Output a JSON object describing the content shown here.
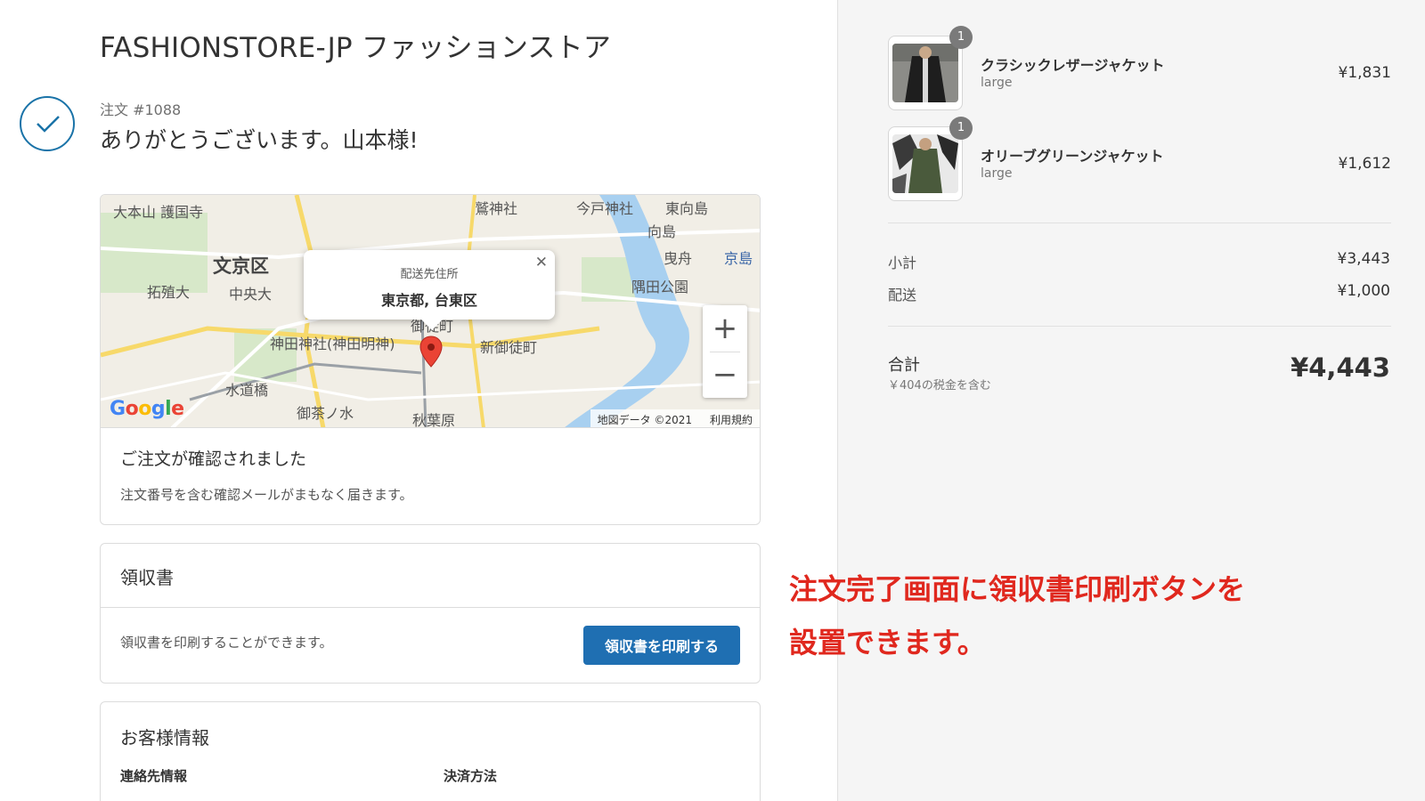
{
  "store": {
    "title": "FASHIONSTORE-JP ファッションストア"
  },
  "order": {
    "number": "注文 #1088",
    "thank_you": "ありがとうございます。山本様!"
  },
  "map": {
    "labels": [
      "大本山 護国寺",
      "鷲神社",
      "今戸神社",
      "東向島",
      "文京区",
      "拓殖大",
      "中央大",
      "曳舟",
      "京島",
      "隅田公園",
      "神田神社(神田明神)",
      "新御徒町",
      "御徒町",
      "水道橋",
      "御茶ノ水",
      "秋葉原",
      "向島"
    ],
    "popup_title": "配送先住所",
    "popup_address": "東京都, 台東区",
    "attribution": "地図データ ©2021",
    "terms": "利用規約",
    "zoom_in": "+",
    "zoom_out": "−"
  },
  "confirmation": {
    "title": "ご注文が確認されました",
    "description": "注文番号を含む確認メールがまもなく届きます。"
  },
  "receipt": {
    "title": "領収書",
    "description": "領収書を印刷することができます。",
    "button": "領収書を印刷する"
  },
  "customer": {
    "title": "お客様情報",
    "contact_label": "連絡先情報",
    "payment_label": "決済方法"
  },
  "annotation": {
    "line1": "注文完了画面に領収書印刷ボタンを",
    "line2": "設置できます。",
    "color": "#e0281e"
  },
  "cart": {
    "items": [
      {
        "name": "クラシックレザージャケット",
        "variant": "large",
        "price": "¥1,831",
        "quantity": "1"
      },
      {
        "name": "オリーブグリーンジャケット",
        "variant": "large",
        "price": "¥1,612",
        "quantity": "1"
      }
    ],
    "subtotal_label": "小計",
    "subtotal": "¥3,443",
    "shipping_label": "配送",
    "shipping": "¥1,000",
    "total_label": "合計",
    "tax_note": "￥404の税金を含む",
    "total": "¥4,443"
  },
  "colors": {
    "accent": "#1f6fb2",
    "check": "#1a73a8",
    "sidebar_bg": "#f5f5f5"
  }
}
